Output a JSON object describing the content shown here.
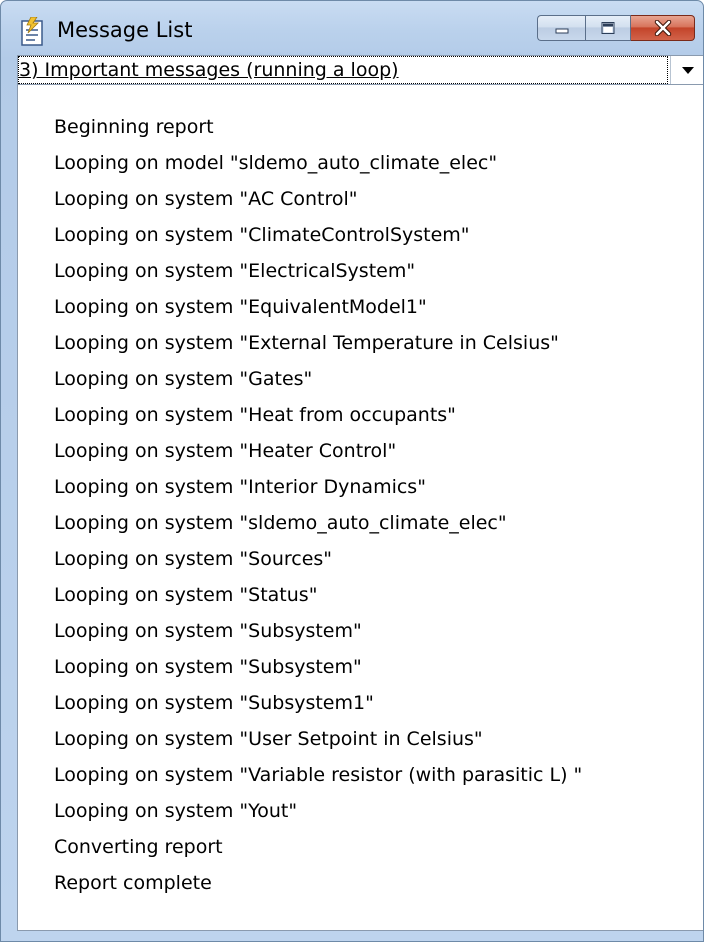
{
  "window": {
    "title": "Message List",
    "icon": "message-list-icon"
  },
  "caption_buttons": {
    "minimize_icon": "minimize-icon",
    "maximize_icon": "maximize-icon",
    "close_icon": "close-icon"
  },
  "filter": {
    "selected": "3) Important messages (running a loop)"
  },
  "messages": [
    "Beginning report",
    "Looping on model \"sldemo_auto_climate_elec\"",
    "Looping on system \"AC Control\"",
    "Looping on system \"ClimateControlSystem\"",
    "Looping on system \"ElectricalSystem\"",
    "Looping on system \"EquivalentModel1\"",
    "Looping on system \"External Temperature in Celsius\"",
    "Looping on system \"Gates\"",
    "Looping on system \"Heat from occupants\"",
    "Looping on system \"Heater Control\"",
    "Looping on system \"Interior Dynamics\"",
    "Looping on system \"sldemo_auto_climate_elec\"",
    "Looping on system \"Sources\"",
    "Looping on system \"Status\"",
    "Looping on system \"Subsystem\"",
    "Looping on system \"Subsystem\"",
    "Looping on system \"Subsystem1\"",
    "Looping on system \"User Setpoint in Celsius\"",
    "Looping on system \"Variable resistor (with parasitic L) \"",
    "Looping on system \"Yout\"",
    "Converting report",
    "Report complete"
  ]
}
